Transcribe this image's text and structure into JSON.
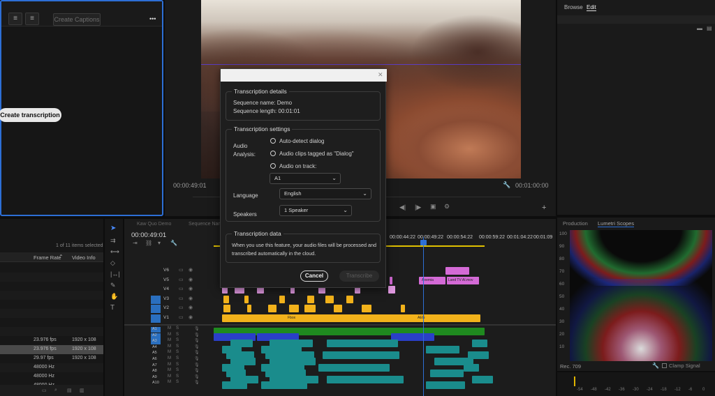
{
  "text_panel": {
    "create_captions_label": "Create Captions",
    "more_label": "•••",
    "create_transcription_label": "Create transcription"
  },
  "program": {
    "timecode_left": "00:00:49:01",
    "timecode_right": "00:01:00:00"
  },
  "browse_panel": {
    "tabs": [
      "Browse",
      "Edit"
    ]
  },
  "project_panel": {
    "items_selected": "1 of 11 items selected",
    "columns": [
      "Frame Rate",
      "Video Info"
    ],
    "rows": [
      {
        "rate": "23.976 fps",
        "info": "1920 x 108"
      },
      {
        "rate": "23.976 fps",
        "info": "1920 x 108"
      },
      {
        "rate": "29.97 fps",
        "info": "1920 x 108"
      },
      {
        "rate": "48000 Hz",
        "info": ""
      },
      {
        "rate": "48000 Hz",
        "info": ""
      },
      {
        "rate": "48000 Hz",
        "info": ""
      }
    ]
  },
  "timeline": {
    "tabs": [
      "Kaw Quo Demo",
      "Sequence Name"
    ],
    "timecode": "00:00:49:01",
    "ruler": [
      "00:00:44:22",
      "00:00:49:22",
      "00:00:54:22",
      "00:00:59:22",
      "00:01:04:22",
      "00:01:09"
    ],
    "video_tracks": [
      "V6",
      "V5",
      "V4",
      "V3",
      "V2",
      "V1"
    ],
    "audio_tracks": [
      "A1",
      "A2",
      "A3",
      "A4",
      "A5",
      "A6",
      "A7",
      "A8",
      "A9",
      "A10"
    ],
    "clip_labels": [
      "Anemia",
      "Land TV AI.mov",
      "Fbox",
      "AEG"
    ]
  },
  "scopes": {
    "tabs": [
      "Production",
      "Lumetri Scopes"
    ],
    "y_ticks": [
      "100",
      "90",
      "80",
      "70",
      "60",
      "50",
      "40",
      "30",
      "20",
      "10"
    ],
    "bottom_left": "Rec. 709",
    "clamp_label": "Clamp Signal"
  },
  "meter": {
    "ticks": [
      "-54",
      "-48",
      "-42",
      "-36",
      "-30",
      "-24",
      "-18",
      "-12",
      "-6",
      "0"
    ]
  },
  "modal": {
    "details": {
      "legend": "Transcription details",
      "sequence_name": "Sequence name: Demo",
      "sequence_length": "Sequence length: 00:01:01"
    },
    "settings": {
      "legend": "Transcription settings",
      "audio_analysis": "Audio Analysis:",
      "options": [
        "Auto-detect dialog",
        "Audio clips tagged as \"Dialog\"",
        "Audio on track:"
      ],
      "track_value": "A1",
      "language_label": "Language",
      "language_value": "English",
      "speakers_label": "Speakers",
      "speakers_value": "1 Speaker"
    },
    "data": {
      "legend": "Transcription data",
      "text_line1": "When you use this feature, your audio files will be processed and",
      "text_line2": "transcribed automatically in the cloud."
    },
    "cancel_label": "Cancel",
    "transcribe_label": "Transcribe",
    "close_icon": "close-icon"
  }
}
